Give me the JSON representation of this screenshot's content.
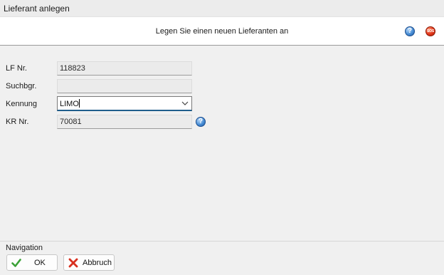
{
  "window": {
    "title": "Lieferant anlegen"
  },
  "header": {
    "text": "Legen Sie einen neuen Lieferanten an",
    "help_icon": "help-icon",
    "sos_icon": "sos-icon",
    "sos_text": "SOS"
  },
  "form": {
    "lf_nr": {
      "label": "LF Nr.",
      "value": "118823"
    },
    "suchbgr": {
      "label": "Suchbgr.",
      "value": ""
    },
    "kennung": {
      "label": "Kennung",
      "value": "LIMO"
    },
    "kr_nr": {
      "label": "KR Nr.",
      "value": "70081",
      "help_icon": "help-icon"
    }
  },
  "navigation": {
    "label": "Navigation",
    "ok_label": "OK",
    "ok_icon": "checkmark-icon",
    "cancel_label": "Abbruch",
    "cancel_icon": "cross-icon"
  },
  "colors": {
    "help_blue": "#4a8fd6",
    "sos_red": "#e3361a",
    "ok_green": "#3aa136",
    "cancel_red": "#d8301f",
    "focus_border": "#1f5e8c"
  }
}
